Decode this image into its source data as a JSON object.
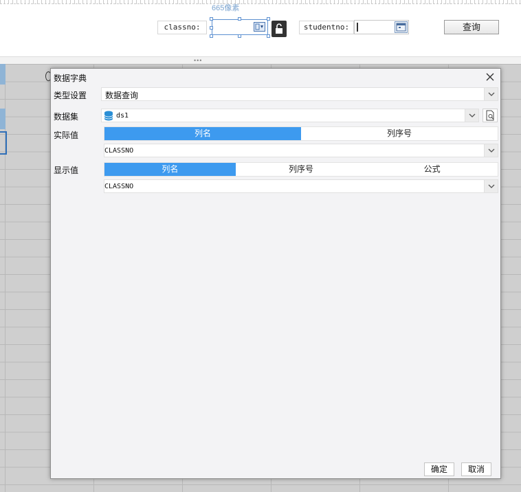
{
  "designer": {
    "width_hint": "665像素",
    "params": [
      {
        "label": "classno:"
      },
      {
        "label": "studentno:"
      }
    ],
    "query_button": "查询"
  },
  "dialog": {
    "title": "数据字典",
    "type_label": "类型设置",
    "type_value": "数据查询",
    "dataset_label": "数据集",
    "dataset_value": "ds1",
    "actual_label": "实际值",
    "actual_tabs": [
      {
        "label": "列名",
        "active": true
      },
      {
        "label": "列序号",
        "active": false
      }
    ],
    "actual_column": "CLASSNO",
    "display_label": "显示值",
    "display_tabs": [
      {
        "label": "列名",
        "active": true
      },
      {
        "label": "列序号",
        "active": false
      },
      {
        "label": "公式",
        "active": false
      }
    ],
    "display_column": "CLASSNO",
    "ok_button": "确定",
    "cancel_button": "取消"
  },
  "colors": {
    "accent": "#3d9aef",
    "selection_border": "#2f6fb8",
    "dataset_icon": "#2a8fd6",
    "hint_text": "#7aa3cf"
  }
}
